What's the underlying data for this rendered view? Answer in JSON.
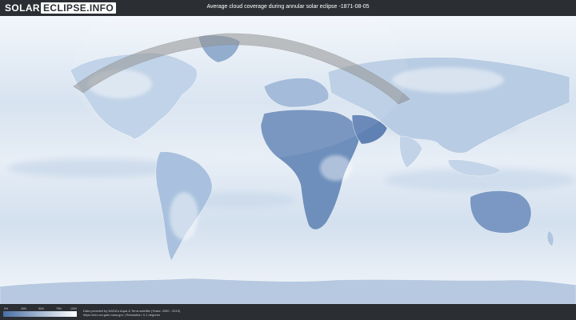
{
  "header": {
    "logo_part1": "SOLAR",
    "logo_part2": "ECLIPSE.INFO",
    "title": "Average cloud coverage during annular solar eclipse -1871-08-05"
  },
  "legend": {
    "ticks": [
      "0%",
      "25%",
      "50%",
      "75%",
      "100%"
    ],
    "colors": [
      "#4a6fa6",
      "#ffffff"
    ]
  },
  "footer": {
    "credit_line1": "Data provided by NASA's Aqua & Terra satellite (Years: 2000 - 2019)",
    "credit_line2": "https://neo.sci.gsfc.nasa.gov | Resolution: 0.1 degrees"
  },
  "colors": {
    "background": "#2b2e33",
    "clear_sky": "#4a6fa6",
    "cloudy": "#ffffff",
    "eclipse_path": "#8a8a8a"
  }
}
